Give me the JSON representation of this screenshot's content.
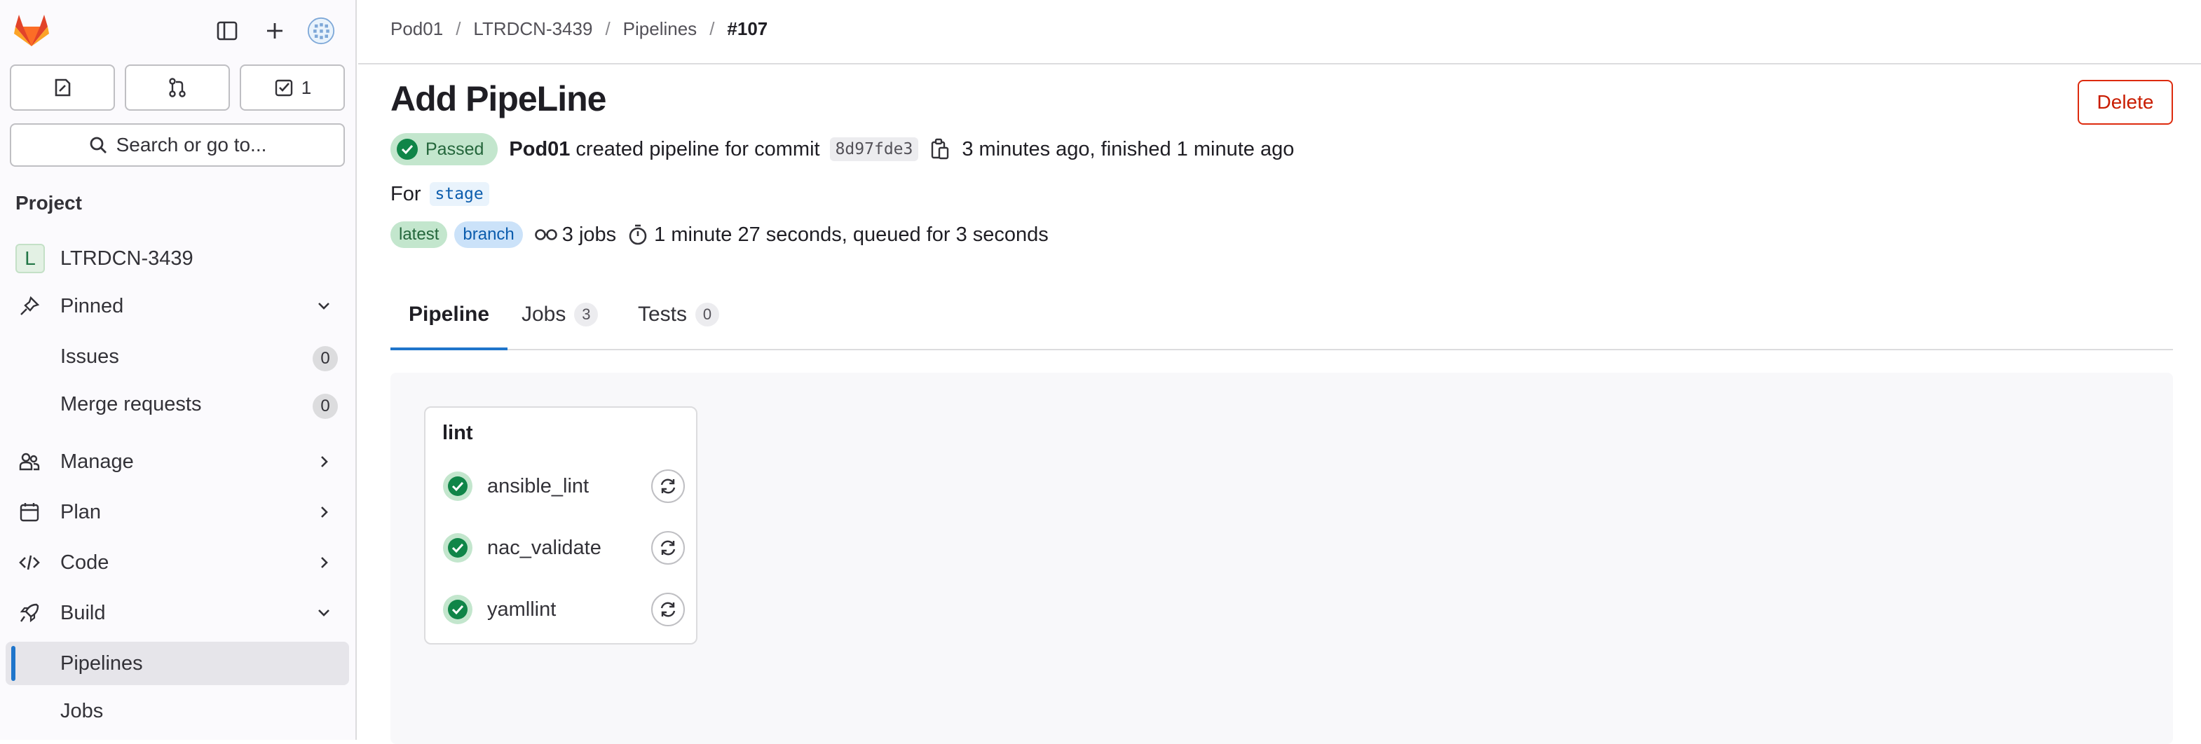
{
  "counters": {
    "todos_count": "1"
  },
  "search": {
    "label": "Search or go to..."
  },
  "sidebar": {
    "section_title": "Project",
    "project": {
      "avatar_letter": "L",
      "name": "LTRDCN-3439"
    },
    "items": [
      {
        "label": "Pinned"
      },
      {
        "label": "Issues",
        "count": "0"
      },
      {
        "label": "Merge requests",
        "count": "0"
      },
      {
        "label": "Manage"
      },
      {
        "label": "Plan"
      },
      {
        "label": "Code"
      },
      {
        "label": "Build"
      },
      {
        "label": "Pipelines"
      },
      {
        "label": "Jobs"
      }
    ]
  },
  "breadcrumb": {
    "items": [
      "Pod01",
      "LTRDCN-3439",
      "Pipelines",
      "#107"
    ]
  },
  "header": {
    "title": "Add PipeLine",
    "delete_label": "Delete"
  },
  "pipeline": {
    "status": "Passed",
    "user": "Pod01",
    "created_text": "created pipeline for commit",
    "commit_sha": "8d97fde3",
    "time_text": "3 minutes ago, finished 1 minute ago",
    "for_label": "For",
    "ref": "stage",
    "tags": [
      "latest",
      "branch"
    ],
    "jobs_text": "3 jobs",
    "duration_text": "1 minute 27 seconds, queued for 3 seconds"
  },
  "tabs": [
    {
      "label": "Pipeline"
    },
    {
      "label": "Jobs",
      "count": "3"
    },
    {
      "label": "Tests",
      "count": "0"
    }
  ],
  "stage": {
    "name": "lint",
    "jobs": [
      {
        "name": "ansible_lint",
        "status": "passed"
      },
      {
        "name": "nac_validate",
        "status": "passed"
      },
      {
        "name": "yamllint",
        "status": "passed"
      }
    ]
  },
  "colors": {
    "accent": "#1f75cb",
    "success": "#108548",
    "danger": "#dd2b0e"
  }
}
